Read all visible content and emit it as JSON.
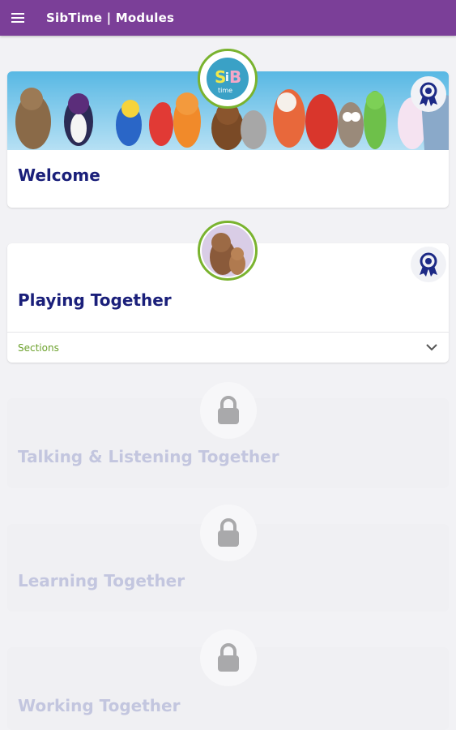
{
  "app_bar": {
    "title": "SibTime | Modules",
    "menu_icon": "hamburger-menu-icon",
    "background": "#7b3f98"
  },
  "modules": [
    {
      "title": "Welcome",
      "state": "unlocked",
      "has_award": true,
      "avatar": "sibtime-logo",
      "banner": "animal-characters-banner"
    },
    {
      "title": "Playing Together",
      "state": "unlocked",
      "has_award": true,
      "avatar": "bear-family-image",
      "sections_label": "Sections",
      "expand_icon": "chevron-down-icon"
    },
    {
      "title": "Talking & Listening Together",
      "state": "locked",
      "lock_icon": "lock-icon"
    },
    {
      "title": "Learning Together",
      "state": "locked",
      "lock_icon": "lock-icon"
    },
    {
      "title": "Working Together",
      "state": "locked",
      "lock_icon": "lock-icon"
    }
  ],
  "colors": {
    "title_text": "#1a1f7a",
    "locked_text": "#c3c6df",
    "accent_green": "#7ab32f",
    "sections_green": "#6ca12c"
  }
}
